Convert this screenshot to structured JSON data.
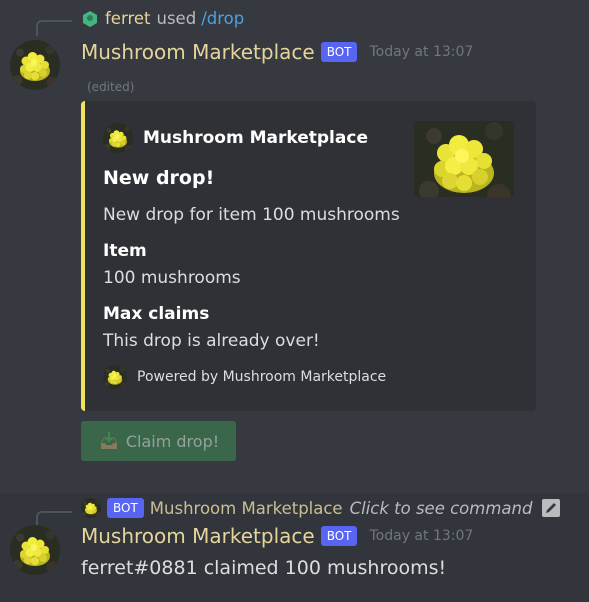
{
  "message1": {
    "reply": {
      "user": "ferret",
      "used_text": "used",
      "command": "/drop"
    },
    "author": "Mushroom Marketplace",
    "bot_tag": "BOT",
    "timestamp": "Today at 13:07",
    "edited": "(edited)",
    "embed": {
      "accent_color": "#f0e25c",
      "author_name": "Mushroom Marketplace",
      "title": "New drop!",
      "description": "New drop for item 100 mushrooms",
      "fields": [
        {
          "name": "Item",
          "value": "100 mushrooms"
        },
        {
          "name": "Max claims",
          "value": "This drop is already over!"
        }
      ],
      "footer": "Powered by Mushroom Marketplace"
    },
    "button": {
      "icon": "inbox-tray-icon",
      "label": "Claim drop!",
      "color": "#3b6a4b",
      "disabled": true
    }
  },
  "message2": {
    "reply": {
      "bot_tag": "BOT",
      "bot_name": "Mushroom Marketplace",
      "click_text": "Click to see command",
      "icon": "command-icon"
    },
    "author": "Mushroom Marketplace",
    "bot_tag": "BOT",
    "timestamp": "Today at 13:07",
    "content": "ferret#0881 claimed 100 mushrooms!"
  }
}
